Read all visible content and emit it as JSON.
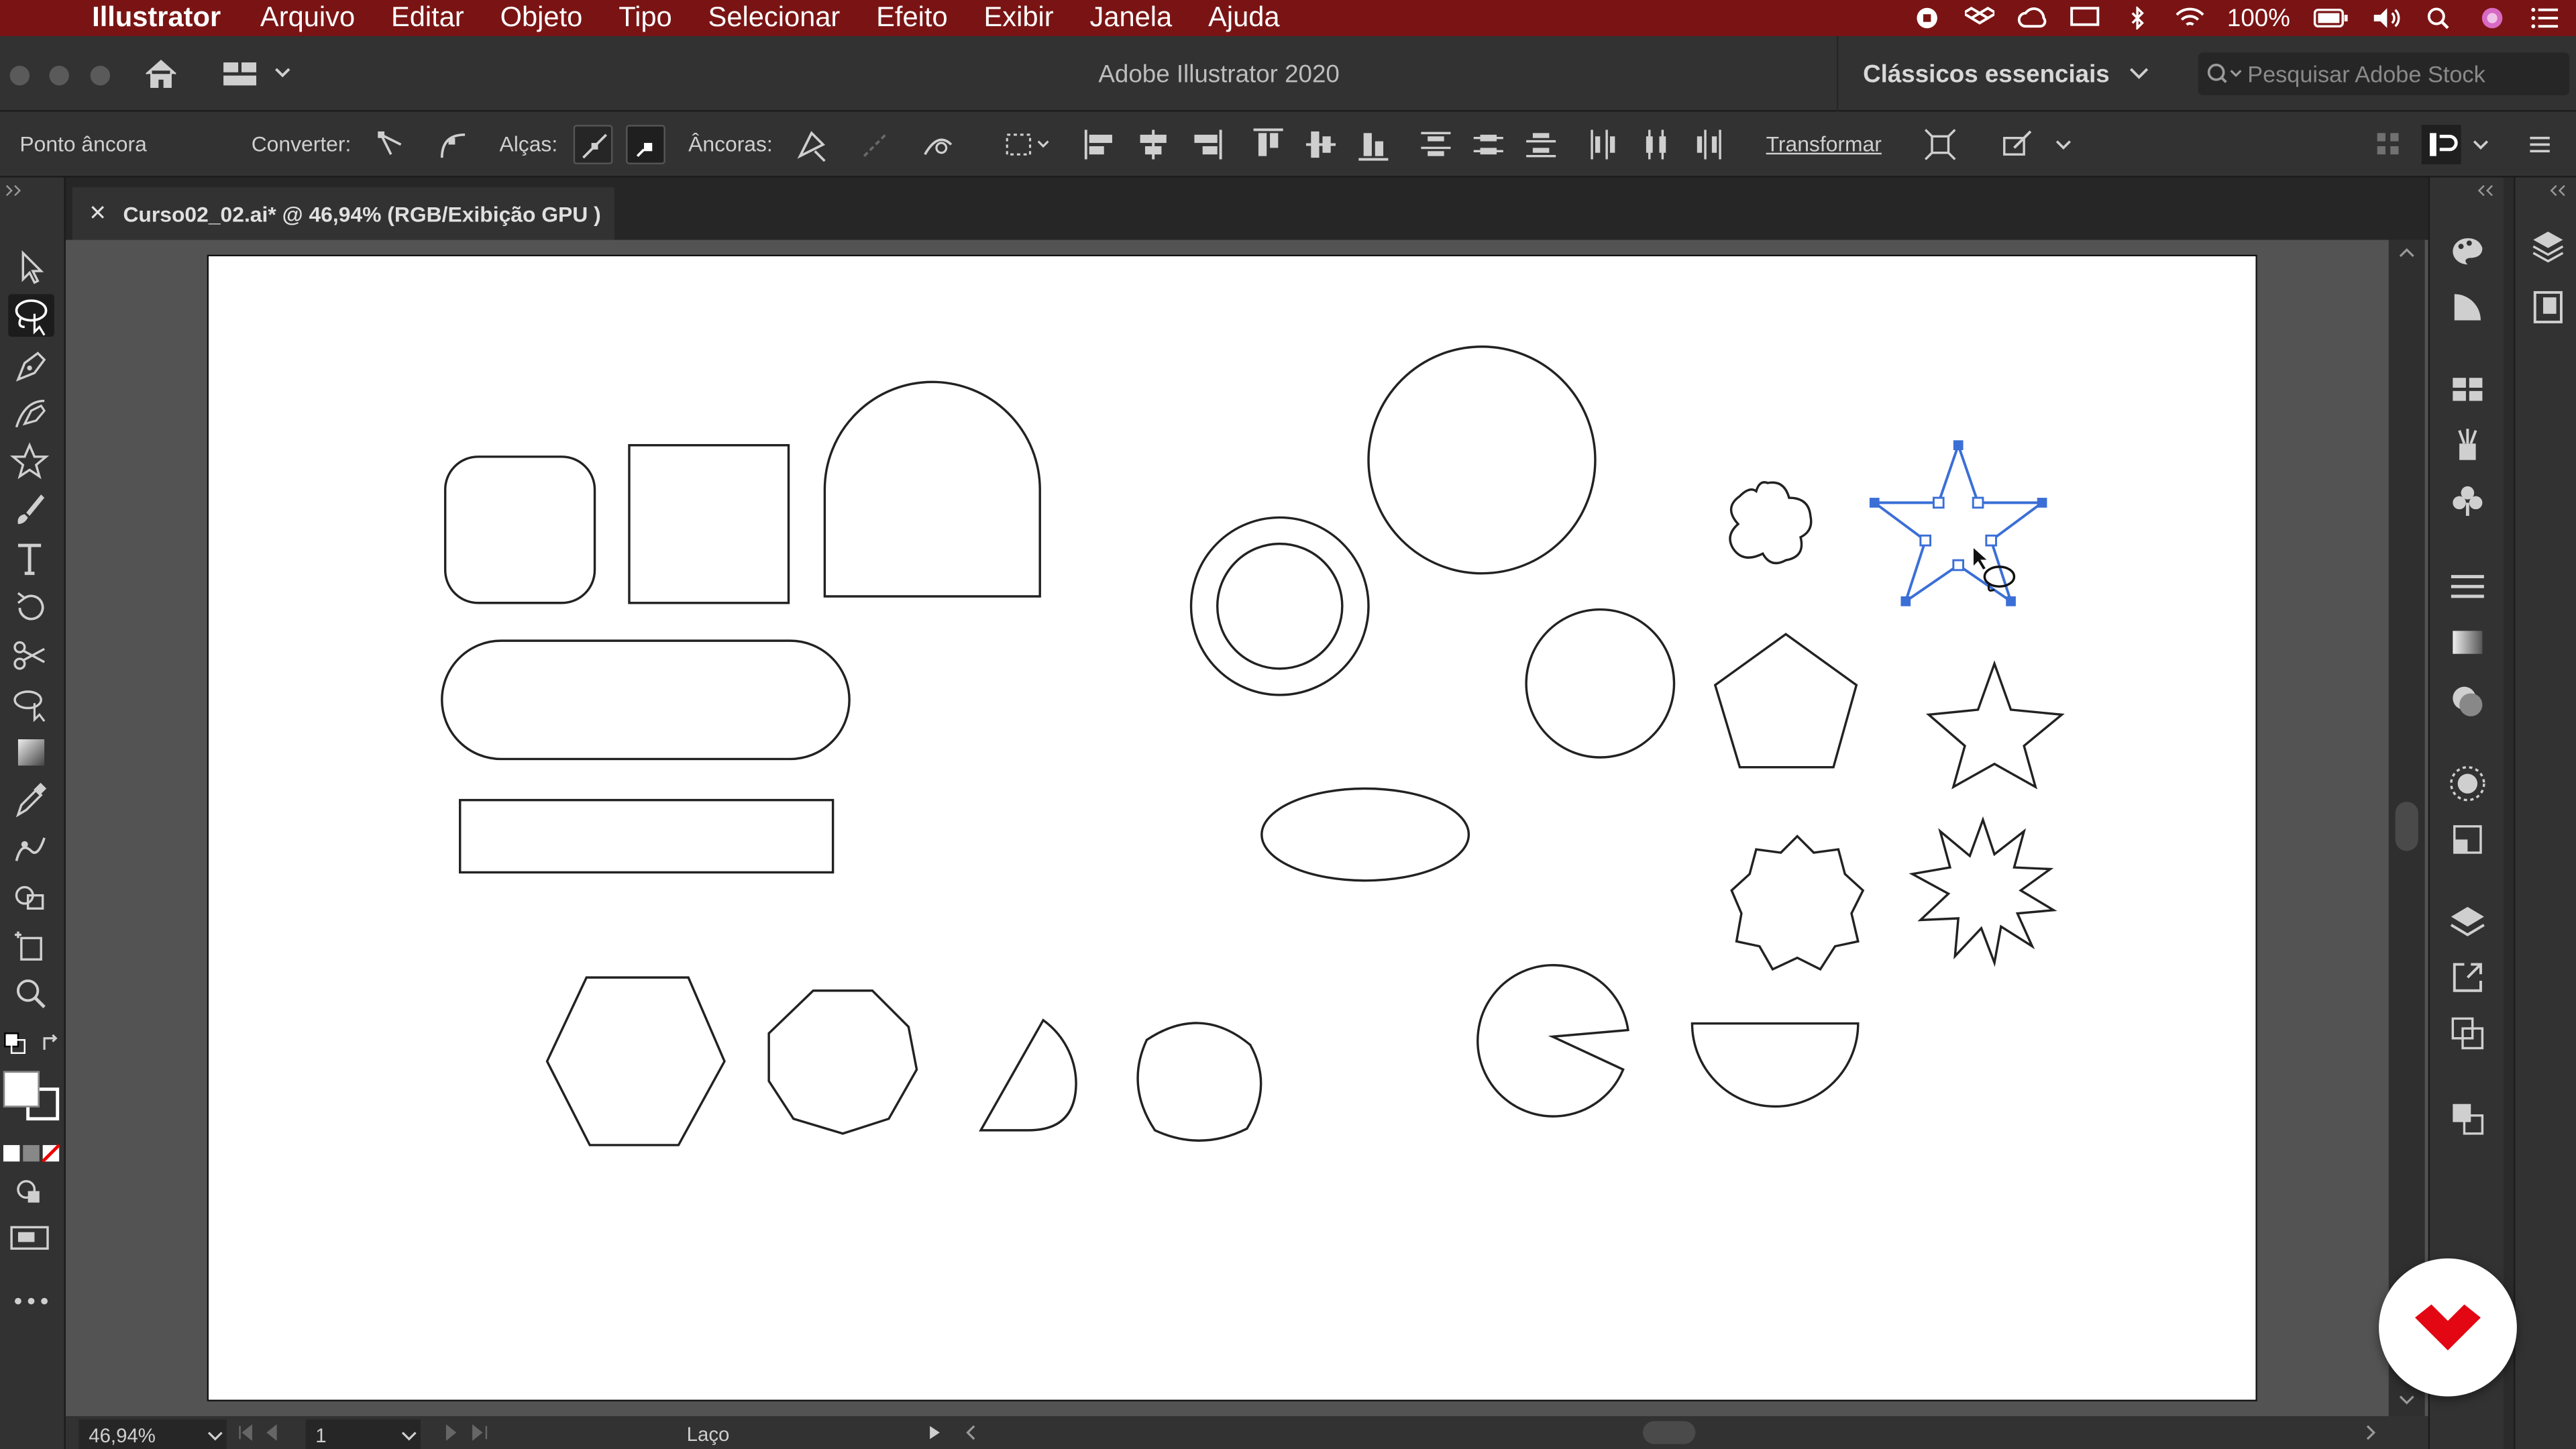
{
  "menubar": {
    "app_name": "Illustrator",
    "items": [
      "Arquivo",
      "Editar",
      "Objeto",
      "Tipo",
      "Selecionar",
      "Efeito",
      "Exibir",
      "Janela",
      "Ajuda"
    ],
    "battery": "100%"
  },
  "titlebar": {
    "title": "Adobe Illustrator 2020",
    "workspace": "Clássicos essenciais",
    "stock_placeholder": "Pesquisar Adobe Stock"
  },
  "controlbar": {
    "anchor_point": "Ponto âncora",
    "convert_label": "Converter:",
    "handles_label": "Alças:",
    "anchors_label": "Âncoras:",
    "transform_label": "Transformar"
  },
  "document": {
    "tab_title": "Curso02_02.ai* @ 46,94% (RGB/Exibição GPU )",
    "close_glyph": "✕"
  },
  "statusbar": {
    "zoom": "46,94%",
    "page": "1",
    "active_tool": "Laço"
  },
  "colors": {
    "menubar_bg": "#7a1414",
    "selection_blue": "#3b6fd6",
    "logo_red": "#e30613"
  },
  "tools": [
    "selection-icon",
    "lasso-icon",
    "pen-icon",
    "curvature-icon",
    "star-icon",
    "brush-icon",
    "type-icon",
    "rotate-icon",
    "scissors-icon",
    "puppet-warp-icon",
    "gradient-icon",
    "eyedropper-icon",
    "blend-icon",
    "shape-builder-icon",
    "artboard-icon",
    "zoom-icon"
  ]
}
